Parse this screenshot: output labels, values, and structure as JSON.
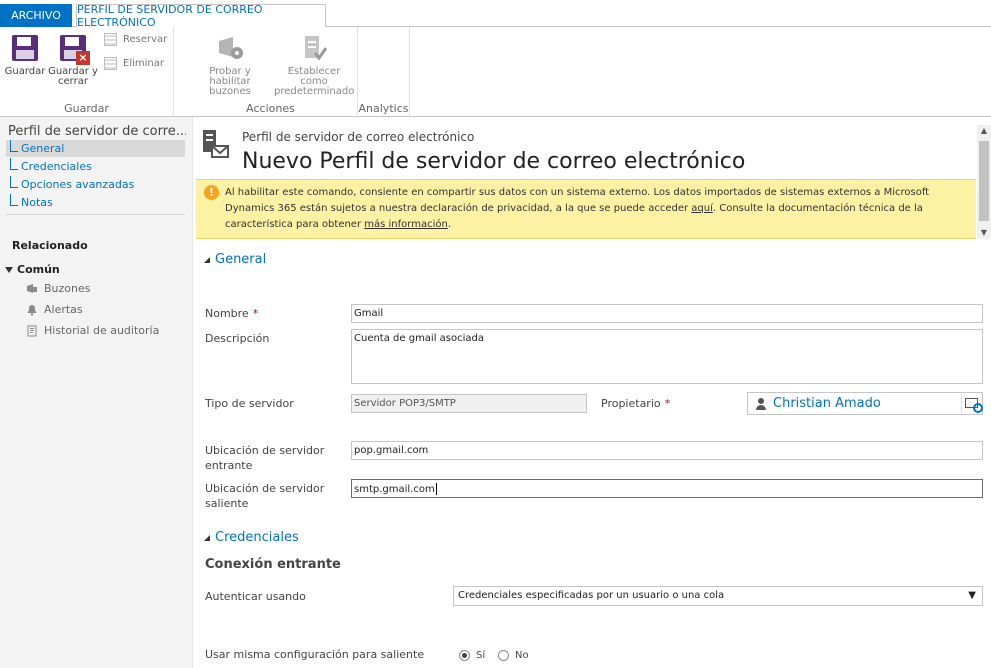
{
  "tabs": {
    "archivo": "ARCHIVO",
    "perfil": "PERFIL DE SERVIDOR DE CORREO ELECTRÓNICO"
  },
  "ribbon": {
    "guardar": {
      "btn_guardar": "Guardar",
      "btn_guardar_cerrar_1": "Guardar y",
      "btn_guardar_cerrar_2": "cerrar",
      "reservar": "Reservar",
      "eliminar": "Eliminar",
      "label": "Guardar"
    },
    "acciones": {
      "btn_probar_1": "Probar y habilitar",
      "btn_probar_2": "buzones",
      "btn_establecer_1": "Establecer como",
      "btn_establecer_2": "predeterminado",
      "label": "Acciones"
    },
    "analytics": {
      "label": "Analytics"
    }
  },
  "leftnav": {
    "title": "Perfil de servidor de corre...",
    "items": [
      {
        "label": "General"
      },
      {
        "label": "Credenciales"
      },
      {
        "label": "Opciones avanzadas"
      },
      {
        "label": "Notas"
      }
    ],
    "related": "Relacionado",
    "common": "Común",
    "common_items": [
      {
        "label": "Buzones"
      },
      {
        "label": "Alertas"
      },
      {
        "label": "Historial de auditoría"
      }
    ]
  },
  "header": {
    "entity": "Perfil de servidor de correo electrónico",
    "title": "Nuevo Perfil de servidor de correo electrónico"
  },
  "warning": {
    "text_1": "Al habilitar este comando, consiente en compartir sus datos con un sistema externo. Los datos importados de sistemas externos a Microsoft Dynamics 365 están sujetos a nuestra declaración de privacidad, a la que se puede acceder ",
    "link_1": "aquí",
    "text_2": ". Consulte la documentación técnica de la característica para obtener ",
    "link_2": "más información",
    "text_3": "."
  },
  "form": {
    "section_general": "General",
    "nombre_label": "Nombre",
    "nombre_value": "Gmail",
    "descripcion_label": "Descripción",
    "descripcion_value": "Cuenta de gmail asociada",
    "tipo_label": "Tipo de servidor",
    "tipo_value": "Servidor POP3/SMTP",
    "propietario_label": "Propietario",
    "propietario_value": "Christian Amado",
    "entrante_label_1": "Ubicación de servidor",
    "entrante_label_2": "entrante",
    "entrante_value": "pop.gmail.com",
    "saliente_label_1": "Ubicación de servidor",
    "saliente_label_2": "saliente",
    "saliente_value": "smtp.gmail.com",
    "section_credenciales": "Credenciales",
    "conexion_entrante": "Conexión entrante",
    "autenticar_label": "Autenticar usando",
    "autenticar_value": "Credenciales especificadas por un usuario o una cola",
    "misma_config_label": "Usar misma configuración para saliente",
    "radio_si": "Sí",
    "radio_no": "No",
    "required_mark": "*"
  },
  "colors": {
    "accent": "#0072c6",
    "warning_bg": "#fdf1a3",
    "nav_bg": "#f3f3f3"
  }
}
